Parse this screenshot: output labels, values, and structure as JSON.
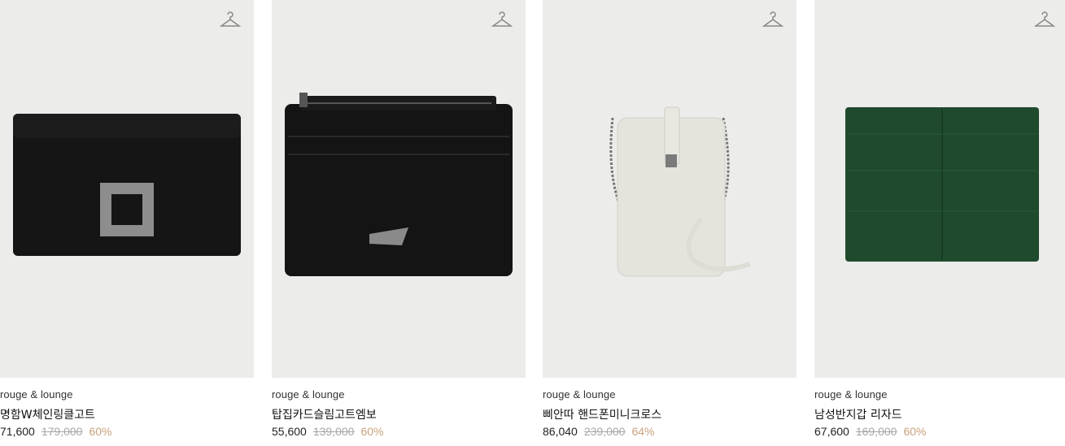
{
  "products": [
    {
      "brand": "rouge & lounge",
      "name": "명함W체인링클고트",
      "sale_price": "71,600",
      "original_price": "179,000",
      "discount": "60%"
    },
    {
      "brand": "rouge & lounge",
      "name": "탑집카드슬림고트엠보",
      "sale_price": "55,600",
      "original_price": "139,000",
      "discount": "60%"
    },
    {
      "brand": "rouge & lounge",
      "name": "삐안따 핸드폰미니크로스",
      "sale_price": "86,040",
      "original_price": "239,000",
      "discount": "64%"
    },
    {
      "brand": "rouge & lounge",
      "name": "남성반지갑 리자드",
      "sale_price": "67,600",
      "original_price": "169,000",
      "discount": "60%"
    }
  ],
  "icons": {
    "wishlist": "hanger-icon"
  },
  "colors": {
    "card_bg": "#ececea",
    "discount": "#c9a27b",
    "original_price": "#a8a8a8"
  }
}
